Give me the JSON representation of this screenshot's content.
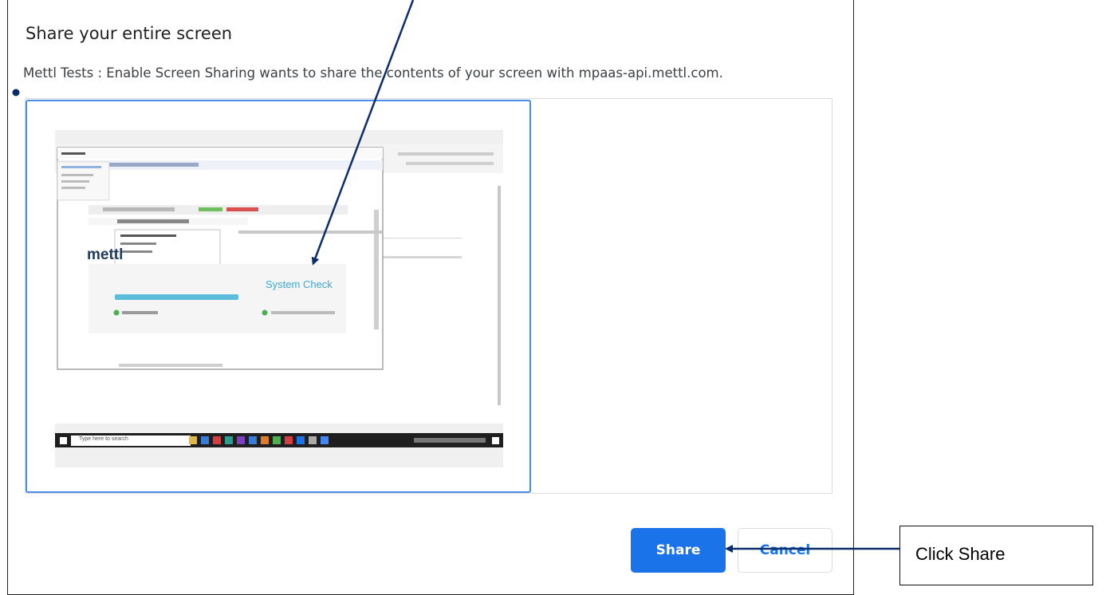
{
  "dialog": {
    "title": "Share your entire screen",
    "description": "Mettl Tests : Enable Screen Sharing wants to share the contents of your screen with mpaas-api.mettl.com.",
    "share_label": "Share",
    "cancel_label": "Cancel"
  },
  "preview": {
    "logo_text": "mettl",
    "system_check_text": "System Check",
    "progress": 0.8,
    "taskbar_search": "Type here to search"
  },
  "annotation": {
    "callout_text": "Click Share"
  },
  "colors": {
    "primary": "#1a73e8",
    "selection_border": "#4a8ce6",
    "annotation_arrow": "#0b2e6b",
    "progress_fill": "#5bbcdc",
    "system_check_text": "#3aa7d6"
  }
}
